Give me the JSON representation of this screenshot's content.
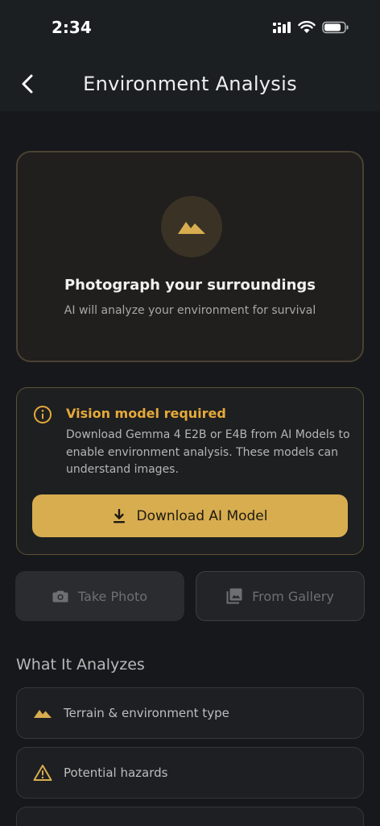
{
  "status_bar": {
    "time": "2:34"
  },
  "nav": {
    "title": "Environment Analysis"
  },
  "photo_card": {
    "icon": "mountain-icon",
    "title": "Photograph your surroundings",
    "subtitle": "AI will analyze your environment for survival"
  },
  "warning": {
    "icon": "info-icon",
    "title": "Vision model required",
    "body": "Download Gemma 4 E2B or E4B from AI Models to enable environment analysis. These models can understand images.",
    "button_label": "Download AI Model",
    "button_icon": "download-icon"
  },
  "actions": {
    "take_photo": {
      "label": "Take Photo",
      "icon": "camera-icon"
    },
    "from_gallery": {
      "label": "From Gallery",
      "icon": "gallery-icon"
    }
  },
  "analyzes": {
    "title": "What It Analyzes",
    "items": [
      {
        "label": "Terrain & environment type",
        "icon": "mountain-icon"
      },
      {
        "label": "Potential hazards",
        "icon": "warning-icon"
      },
      {
        "label": "",
        "icon": ""
      }
    ]
  },
  "colors": {
    "accent": "#d8ad50",
    "warning_title": "#e6a93a",
    "background": "#17181b"
  }
}
